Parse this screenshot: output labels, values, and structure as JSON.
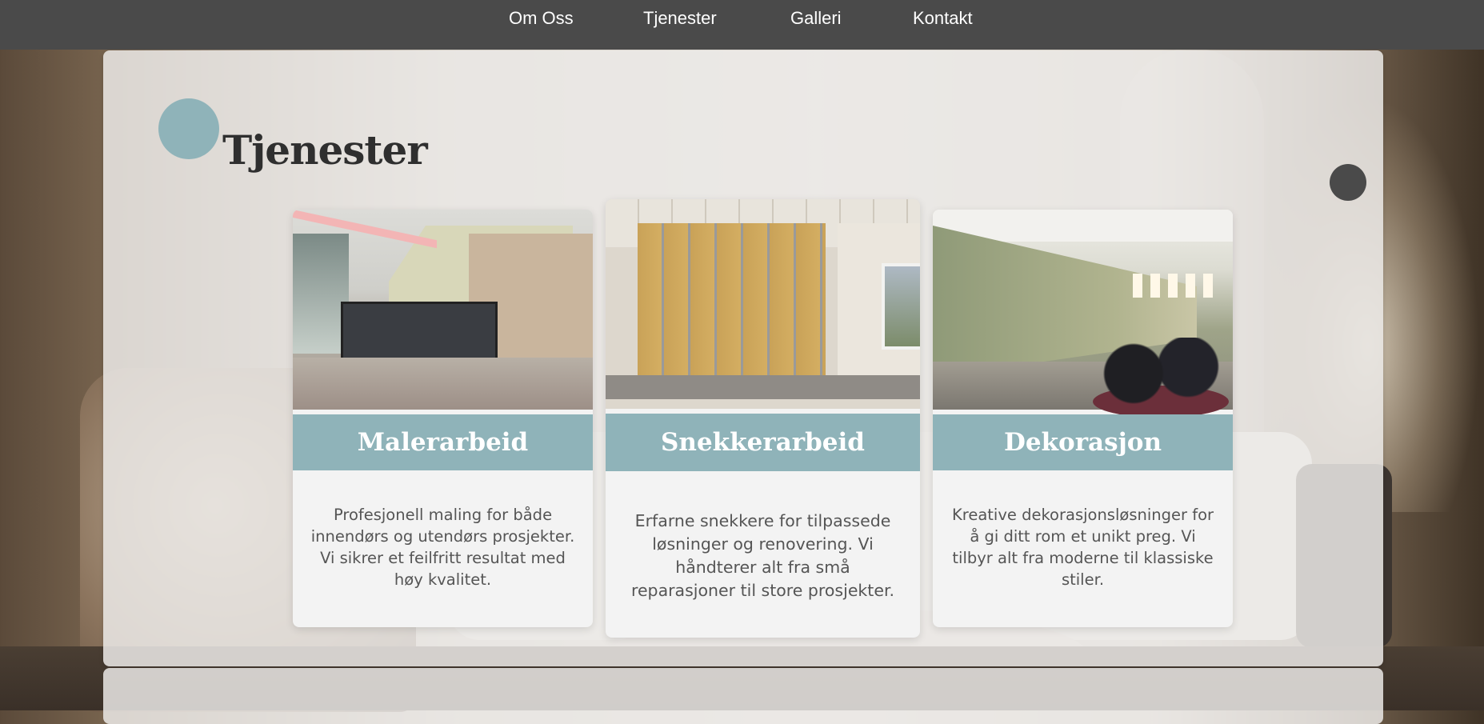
{
  "nav": {
    "items": [
      "Om Oss",
      "Tjenester",
      "Galleri",
      "Kontakt"
    ]
  },
  "section": {
    "title": "Tjenester"
  },
  "cards": [
    {
      "title": "Malerarbeid",
      "description": "Profesjonell maling for både innendørs og utendørs prosjekter. Vi sikrer et feilfritt resultat med høy kvalitet."
    },
    {
      "title": "Snekkerarbeid",
      "description": "Erfarne snekkere for tilpassede løsninger og renovering. Vi håndterer alt fra små reparasjoner til store prosjekter."
    },
    {
      "title": "Dekorasjon",
      "description": "Kreative dekorasjonsløsninger for å gi ditt rom et unikt preg. Vi tilbyr alt fra moderne til klassiske stiler."
    }
  ],
  "colors": {
    "nav_bg": "#4a4a4a",
    "accent": "#8fb3b9",
    "heading": "#2f2f2f",
    "card_bg": "#f3f3f3"
  }
}
